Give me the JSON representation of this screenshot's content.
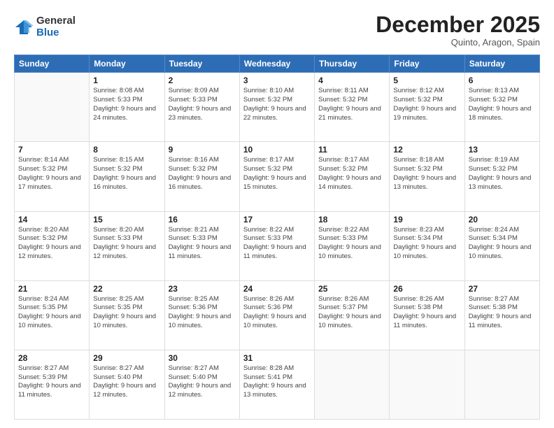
{
  "logo": {
    "general": "General",
    "blue": "Blue"
  },
  "title": "December 2025",
  "location": "Quinto, Aragon, Spain",
  "days_header": [
    "Sunday",
    "Monday",
    "Tuesday",
    "Wednesday",
    "Thursday",
    "Friday",
    "Saturday"
  ],
  "weeks": [
    [
      {
        "day": "",
        "sunrise": "",
        "sunset": "",
        "daylight": ""
      },
      {
        "day": "1",
        "sunrise": "8:08 AM",
        "sunset": "5:33 PM",
        "daylight": "9 hours and 24 minutes."
      },
      {
        "day": "2",
        "sunrise": "8:09 AM",
        "sunset": "5:33 PM",
        "daylight": "9 hours and 23 minutes."
      },
      {
        "day": "3",
        "sunrise": "8:10 AM",
        "sunset": "5:32 PM",
        "daylight": "9 hours and 22 minutes."
      },
      {
        "day": "4",
        "sunrise": "8:11 AM",
        "sunset": "5:32 PM",
        "daylight": "9 hours and 21 minutes."
      },
      {
        "day": "5",
        "sunrise": "8:12 AM",
        "sunset": "5:32 PM",
        "daylight": "9 hours and 19 minutes."
      },
      {
        "day": "6",
        "sunrise": "8:13 AM",
        "sunset": "5:32 PM",
        "daylight": "9 hours and 18 minutes."
      }
    ],
    [
      {
        "day": "7",
        "sunrise": "8:14 AM",
        "sunset": "5:32 PM",
        "daylight": "9 hours and 17 minutes."
      },
      {
        "day": "8",
        "sunrise": "8:15 AM",
        "sunset": "5:32 PM",
        "daylight": "9 hours and 16 minutes."
      },
      {
        "day": "9",
        "sunrise": "8:16 AM",
        "sunset": "5:32 PM",
        "daylight": "9 hours and 16 minutes."
      },
      {
        "day": "10",
        "sunrise": "8:17 AM",
        "sunset": "5:32 PM",
        "daylight": "9 hours and 15 minutes."
      },
      {
        "day": "11",
        "sunrise": "8:17 AM",
        "sunset": "5:32 PM",
        "daylight": "9 hours and 14 minutes."
      },
      {
        "day": "12",
        "sunrise": "8:18 AM",
        "sunset": "5:32 PM",
        "daylight": "9 hours and 13 minutes."
      },
      {
        "day": "13",
        "sunrise": "8:19 AM",
        "sunset": "5:32 PM",
        "daylight": "9 hours and 13 minutes."
      }
    ],
    [
      {
        "day": "14",
        "sunrise": "8:20 AM",
        "sunset": "5:32 PM",
        "daylight": "9 hours and 12 minutes."
      },
      {
        "day": "15",
        "sunrise": "8:20 AM",
        "sunset": "5:33 PM",
        "daylight": "9 hours and 12 minutes."
      },
      {
        "day": "16",
        "sunrise": "8:21 AM",
        "sunset": "5:33 PM",
        "daylight": "9 hours and 11 minutes."
      },
      {
        "day": "17",
        "sunrise": "8:22 AM",
        "sunset": "5:33 PM",
        "daylight": "9 hours and 11 minutes."
      },
      {
        "day": "18",
        "sunrise": "8:22 AM",
        "sunset": "5:33 PM",
        "daylight": "9 hours and 10 minutes."
      },
      {
        "day": "19",
        "sunrise": "8:23 AM",
        "sunset": "5:34 PM",
        "daylight": "9 hours and 10 minutes."
      },
      {
        "day": "20",
        "sunrise": "8:24 AM",
        "sunset": "5:34 PM",
        "daylight": "9 hours and 10 minutes."
      }
    ],
    [
      {
        "day": "21",
        "sunrise": "8:24 AM",
        "sunset": "5:35 PM",
        "daylight": "9 hours and 10 minutes."
      },
      {
        "day": "22",
        "sunrise": "8:25 AM",
        "sunset": "5:35 PM",
        "daylight": "9 hours and 10 minutes."
      },
      {
        "day": "23",
        "sunrise": "8:25 AM",
        "sunset": "5:36 PM",
        "daylight": "9 hours and 10 minutes."
      },
      {
        "day": "24",
        "sunrise": "8:26 AM",
        "sunset": "5:36 PM",
        "daylight": "9 hours and 10 minutes."
      },
      {
        "day": "25",
        "sunrise": "8:26 AM",
        "sunset": "5:37 PM",
        "daylight": "9 hours and 10 minutes."
      },
      {
        "day": "26",
        "sunrise": "8:26 AM",
        "sunset": "5:38 PM",
        "daylight": "9 hours and 11 minutes."
      },
      {
        "day": "27",
        "sunrise": "8:27 AM",
        "sunset": "5:38 PM",
        "daylight": "9 hours and 11 minutes."
      }
    ],
    [
      {
        "day": "28",
        "sunrise": "8:27 AM",
        "sunset": "5:39 PM",
        "daylight": "9 hours and 11 minutes."
      },
      {
        "day": "29",
        "sunrise": "8:27 AM",
        "sunset": "5:40 PM",
        "daylight": "9 hours and 12 minutes."
      },
      {
        "day": "30",
        "sunrise": "8:27 AM",
        "sunset": "5:40 PM",
        "daylight": "9 hours and 12 minutes."
      },
      {
        "day": "31",
        "sunrise": "8:28 AM",
        "sunset": "5:41 PM",
        "daylight": "9 hours and 13 minutes."
      },
      {
        "day": "",
        "sunrise": "",
        "sunset": "",
        "daylight": ""
      },
      {
        "day": "",
        "sunrise": "",
        "sunset": "",
        "daylight": ""
      },
      {
        "day": "",
        "sunrise": "",
        "sunset": "",
        "daylight": ""
      }
    ]
  ]
}
